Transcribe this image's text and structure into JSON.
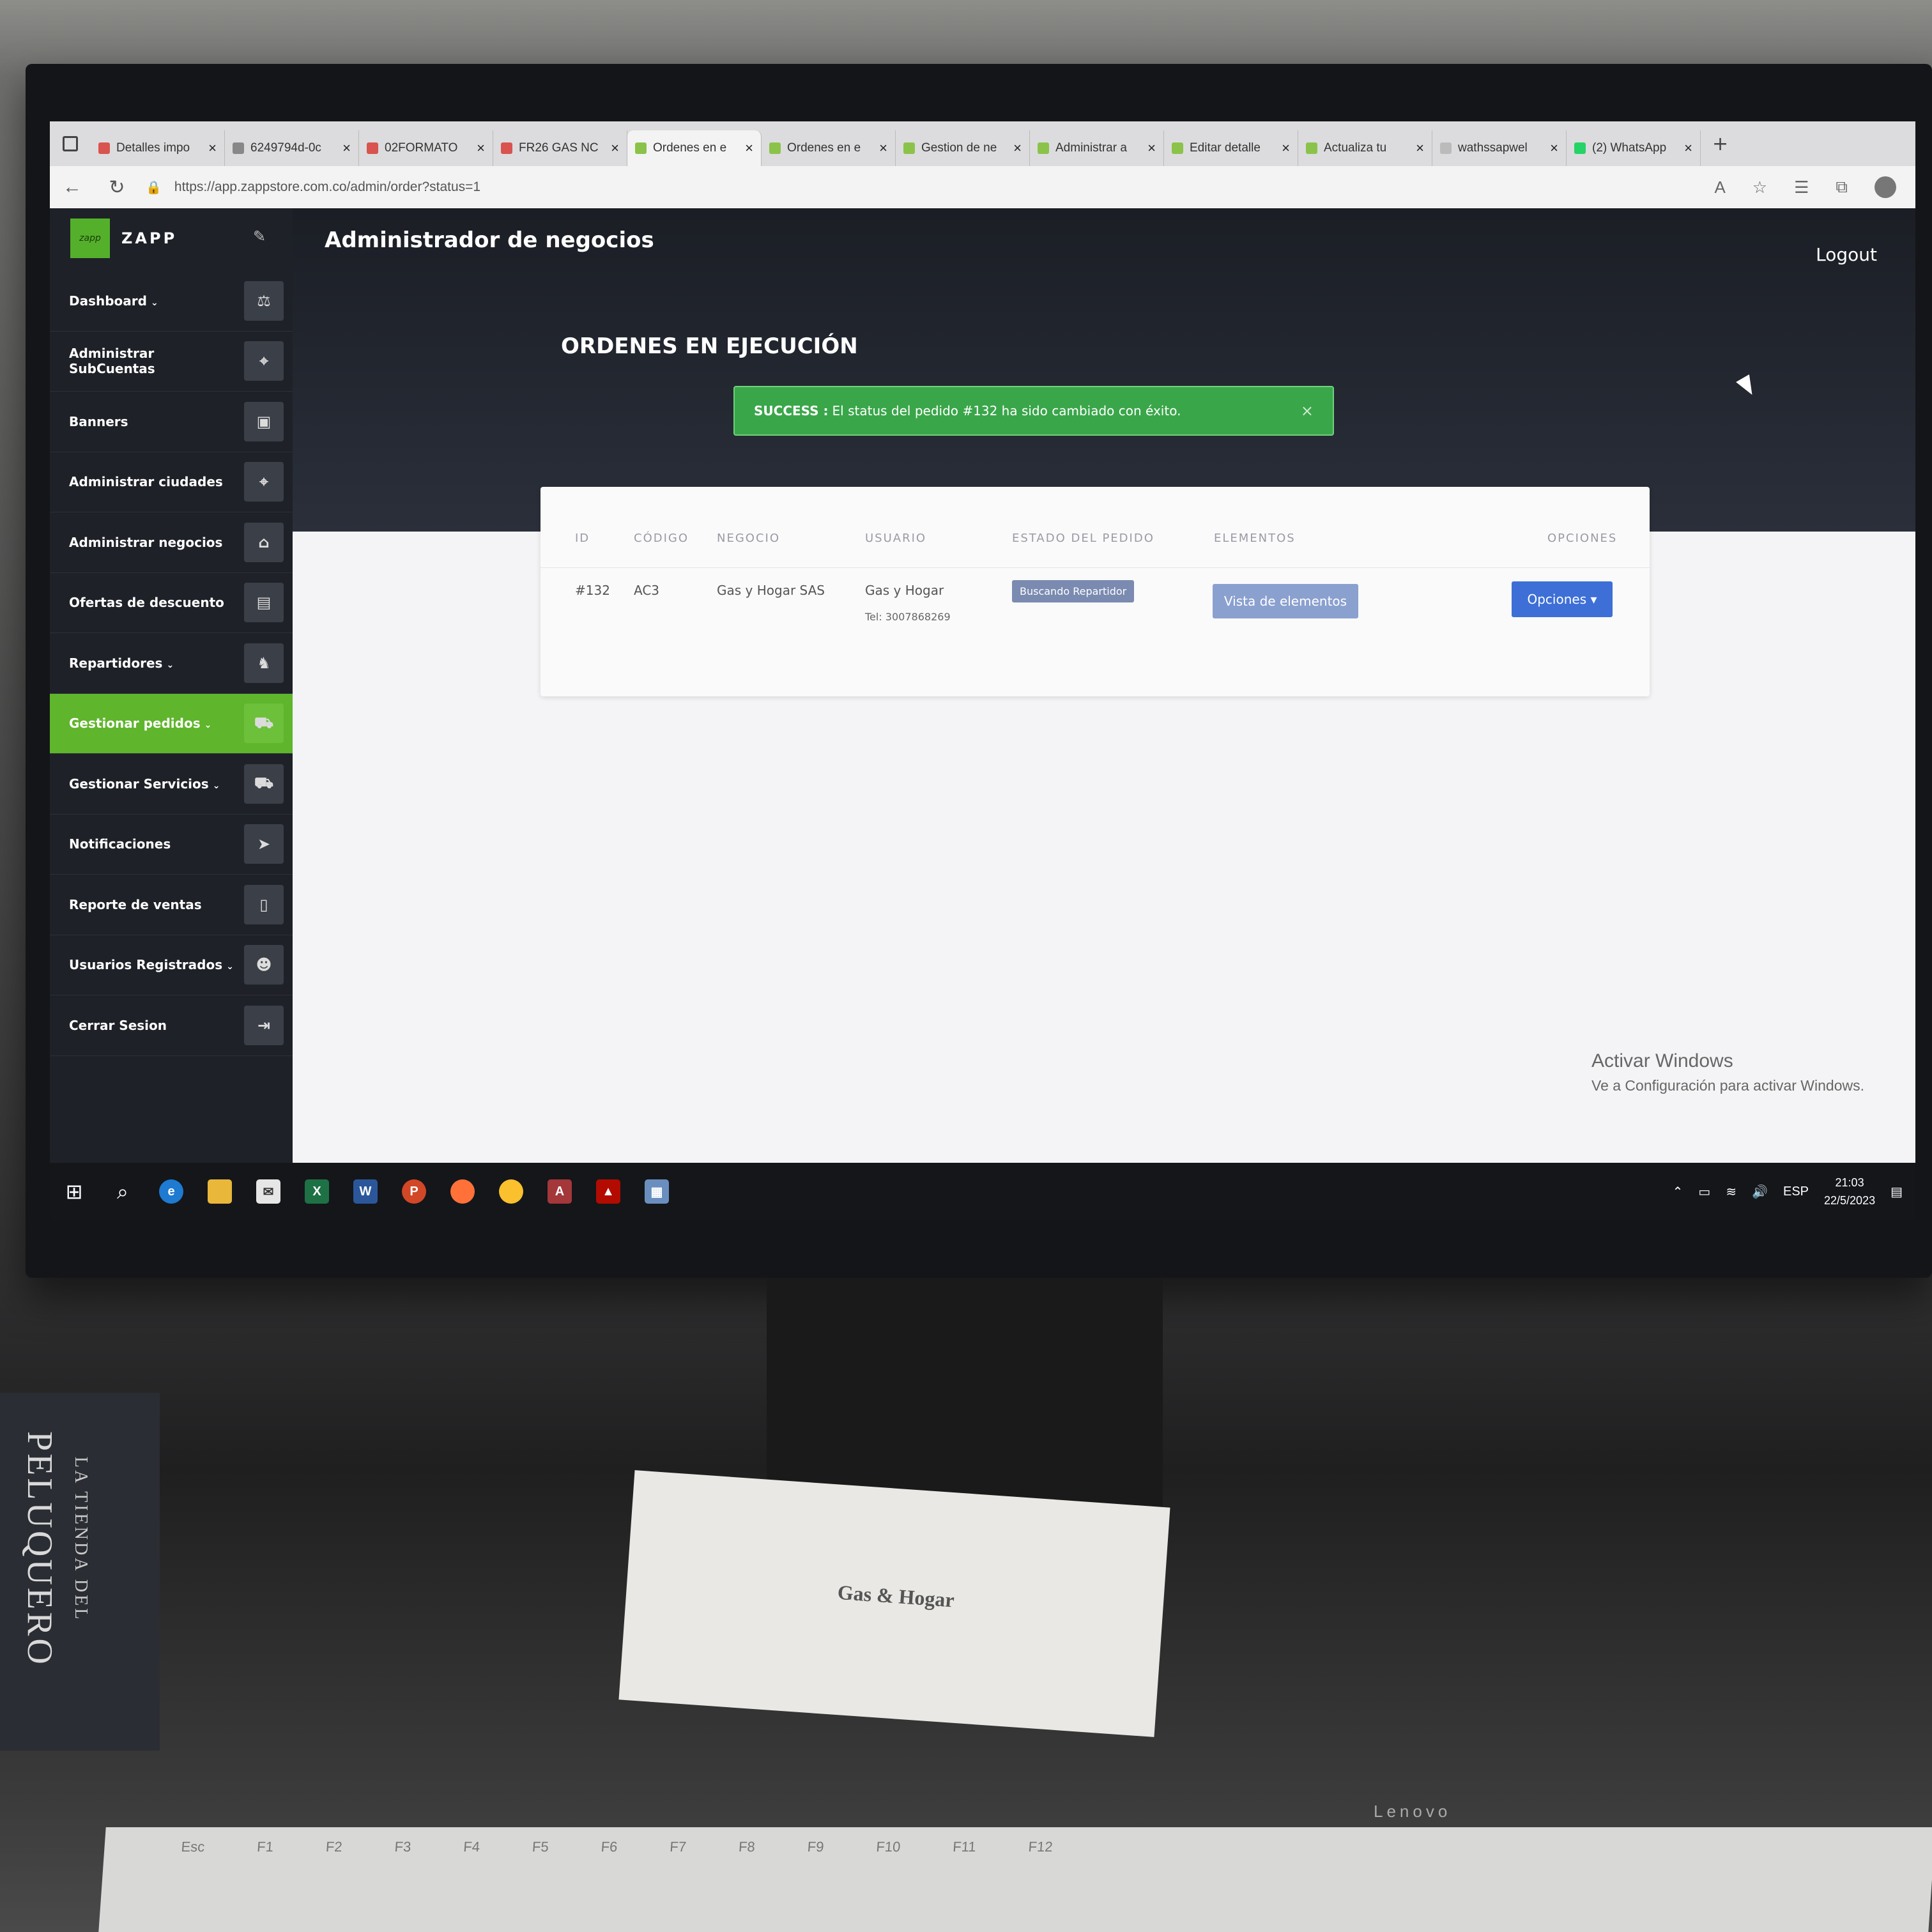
{
  "browser": {
    "tabs": [
      {
        "label": "Detalles impo",
        "icon_color": "#d9534f",
        "active": false
      },
      {
        "label": "6249794d-0c",
        "icon_color": "#888888",
        "active": false
      },
      {
        "label": "02FORMATO",
        "icon_color": "#d9534f",
        "active": false
      },
      {
        "label": "FR26 GAS NC",
        "icon_color": "#d9534f",
        "active": false
      },
      {
        "label": "Ordenes en e",
        "icon_color": "#8bc34a",
        "active": true
      },
      {
        "label": "Ordenes en e",
        "icon_color": "#8bc34a",
        "active": false
      },
      {
        "label": "Gestion de ne",
        "icon_color": "#8bc34a",
        "active": false
      },
      {
        "label": "Administrar a",
        "icon_color": "#8bc34a",
        "active": false
      },
      {
        "label": "Editar detalle",
        "icon_color": "#8bc34a",
        "active": false
      },
      {
        "label": "Actualiza tu",
        "icon_color": "#8bc34a",
        "active": false
      },
      {
        "label": "wathssapwel",
        "icon_color": "#bbbbbb",
        "active": false
      },
      {
        "label": "(2) WhatsApp",
        "icon_color": "#25d366",
        "active": false
      }
    ],
    "url": "https://app.zappstore.com.co/admin/order?status=1"
  },
  "brand": {
    "name": "ZAPP",
    "logo_text": "zapp"
  },
  "sidebar": {
    "items": [
      {
        "label": "Dashboard",
        "caret": "⌄",
        "icon": "⚖"
      },
      {
        "label": "Administrar SubCuentas",
        "caret": "",
        "icon": "⌖"
      },
      {
        "label": "Banners",
        "caret": "",
        "icon": "▣"
      },
      {
        "label": "Administrar ciudades",
        "caret": "",
        "icon": "⌖"
      },
      {
        "label": "Administrar negocios",
        "caret": "",
        "icon": "⌂"
      },
      {
        "label": "Ofertas de descuento",
        "caret": "",
        "icon": "▤"
      },
      {
        "label": "Repartidores",
        "caret": "⌄",
        "icon": "♞"
      },
      {
        "label": "Gestionar pedidos",
        "caret": "⌄",
        "icon": "⛟"
      },
      {
        "label": "Gestionar Servicios",
        "caret": "⌄",
        "icon": "⛟"
      },
      {
        "label": "Notificaciones",
        "caret": "",
        "icon": "➤"
      },
      {
        "label": "Reporte de ventas",
        "caret": "",
        "icon": "▯"
      },
      {
        "label": "Usuarios Registrados",
        "caret": "⌄",
        "icon": "☻"
      },
      {
        "label": "Cerrar Sesion",
        "caret": "",
        "icon": "⇥"
      }
    ],
    "active_index": 7
  },
  "header": {
    "title": "Administrador de negocios",
    "logout": "Logout"
  },
  "main": {
    "page_title": "ORDENES EN EJECUCIÓN",
    "alert": {
      "prefix": "SUCCESS :",
      "message": "El status del pedido #132 ha sido cambiado con éxito.",
      "close": "×"
    },
    "table": {
      "headers": [
        "ID",
        "CÓDIGO",
        "NEGOCIO",
        "USUARIO",
        "ESTADO DEL PEDIDO",
        "ELEMENTOS",
        "OPCIONES"
      ],
      "rows": [
        {
          "id": "#132",
          "codigo": "AC3",
          "negocio": "Gas y Hogar SAS",
          "usuario": "Gas y Hogar",
          "tel": "Tel: 3007868269",
          "estado": "Buscando Repartidor",
          "elementos": "Vista de elementos",
          "opciones": "Opciones ▾"
        }
      ]
    }
  },
  "watermark": {
    "line1": "Activar Windows",
    "line2": "Ve a Configuración para activar Windows."
  },
  "taskbar": {
    "lang": "ESP",
    "time": "21:03",
    "date": "22/5/2023"
  },
  "desk": {
    "book_title": "PELUQUERO",
    "book_subtitle": "LA TIENDA DEL",
    "paper_logo": "Gas & Hogar",
    "monitor_brand": "Lenovo",
    "fkeys": [
      "Esc",
      "F1",
      "F2",
      "F3",
      "F4",
      "F5",
      "F6",
      "F7",
      "F8",
      "F9",
      "F10",
      "F11",
      "F12"
    ]
  }
}
